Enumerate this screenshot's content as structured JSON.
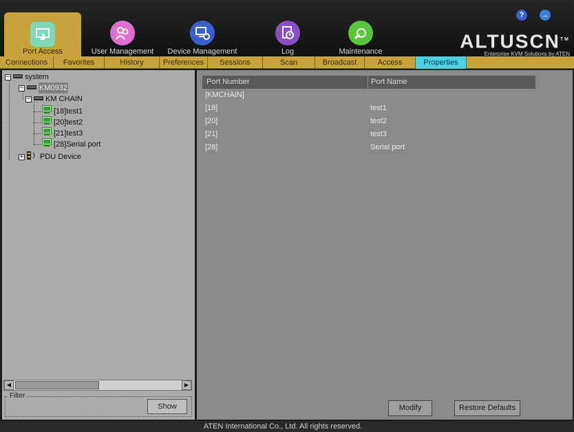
{
  "header": {
    "modules": [
      {
        "label": "Port Access",
        "icon": "port-access-icon",
        "color": "#7fd8b8",
        "active": true
      },
      {
        "label": "User Management",
        "icon": "users-icon",
        "color": "#e070d0"
      },
      {
        "label": "Device Management",
        "icon": "device-icon",
        "color": "#3a5fd0"
      },
      {
        "label": "Log",
        "icon": "log-icon",
        "color": "#8a4fc8"
      },
      {
        "label": "Maintenance",
        "icon": "maintenance-icon",
        "color": "#5ac43a"
      }
    ],
    "brand_name": "ALTUSCN",
    "brand_tm": "TM",
    "brand_tagline": "Enterprise KVM Solutions by ATEN",
    "help_icon_label": "?",
    "logout_icon_label": "→"
  },
  "subtabs": [
    {
      "label": "Connections"
    },
    {
      "label": "Favorites"
    },
    {
      "label": "History"
    },
    {
      "label": "Preferences"
    },
    {
      "label": "Sessions"
    },
    {
      "label": "Scan"
    },
    {
      "label": "Broadcast"
    },
    {
      "label": "Access"
    },
    {
      "label": "Properties",
      "active": true
    }
  ],
  "tree": {
    "root": "system",
    "device": "KM0932",
    "chain": "KM CHAIN",
    "ports": [
      "[18]test1",
      "[20]test2",
      "[21]test3",
      "[28]Serial port"
    ],
    "pdu": "PDU Device",
    "expander_collapsed": "+",
    "expander_expanded": "−"
  },
  "filter": {
    "label": "Filter",
    "show_button": "Show"
  },
  "scroll": {
    "left_arrow": "◀",
    "right_arrow": "▶"
  },
  "table": {
    "headers": [
      "Port Number",
      "Port Name"
    ],
    "rows": [
      [
        "[KMCHAIN]",
        ""
      ],
      [
        "[18]",
        "test1"
      ],
      [
        "[20]",
        "test2"
      ],
      [
        "[21]",
        "test3"
      ],
      [
        "[28]",
        "Serial port"
      ]
    ]
  },
  "buttons": {
    "modify": "Modify",
    "restore": "Restore Defaults"
  },
  "footer": "ATEN International Co., Ltd. All rights reserved."
}
